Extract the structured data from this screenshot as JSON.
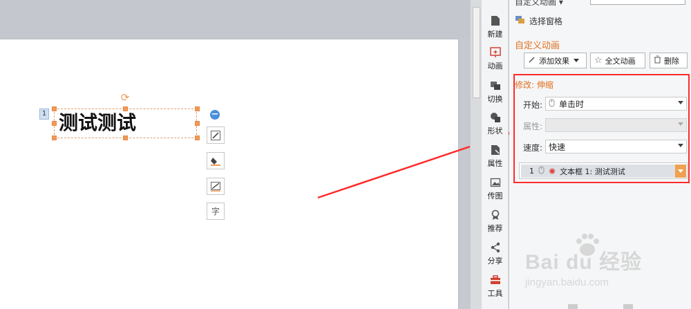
{
  "panel": {
    "top_cut_label": "自定义动画 ▾",
    "select_pane_label": "选择窗格",
    "section_title": "自定义动画",
    "add_effect_label": "添加效果",
    "full_text_anim_label": "全文动画",
    "delete_label": "删除",
    "modify_label": "修改: 伸缩",
    "start_label": "开始:",
    "start_value": "单击时",
    "property_label": "属性:",
    "property_value": "",
    "speed_label": "速度:",
    "speed_value": "快速",
    "anim_item_index": "1",
    "anim_item_label": "文本框 1: 测试测试"
  },
  "sidebar": {
    "items": [
      {
        "label": "新建",
        "icon": "new-file-icon"
      },
      {
        "label": "动画",
        "icon": "animation-icon"
      },
      {
        "label": "切换",
        "icon": "transition-icon"
      },
      {
        "label": "形状",
        "icon": "shape-icon"
      },
      {
        "label": "属性",
        "icon": "property-icon"
      },
      {
        "label": "传图",
        "icon": "upload-image-icon"
      },
      {
        "label": "推荐",
        "icon": "recommend-icon"
      },
      {
        "label": "分享",
        "icon": "share-icon"
      },
      {
        "label": "工具",
        "icon": "toolbox-icon"
      }
    ]
  },
  "slide": {
    "textbox_text": "测试测试",
    "anim_badge": "1"
  },
  "float_tools": [
    {
      "icon": "edit-shape-icon"
    },
    {
      "icon": "fill-color-icon"
    },
    {
      "icon": "line-style-icon"
    },
    {
      "icon": "font-icon",
      "glyph": "字"
    }
  ],
  "watermark": {
    "main": "Bai du 经验",
    "sub": "jingyan.baidu.com"
  },
  "colors": {
    "accent_orange": "#e07020",
    "highlight_red": "#ff2a2a",
    "handle_orange": "#f09a55"
  }
}
